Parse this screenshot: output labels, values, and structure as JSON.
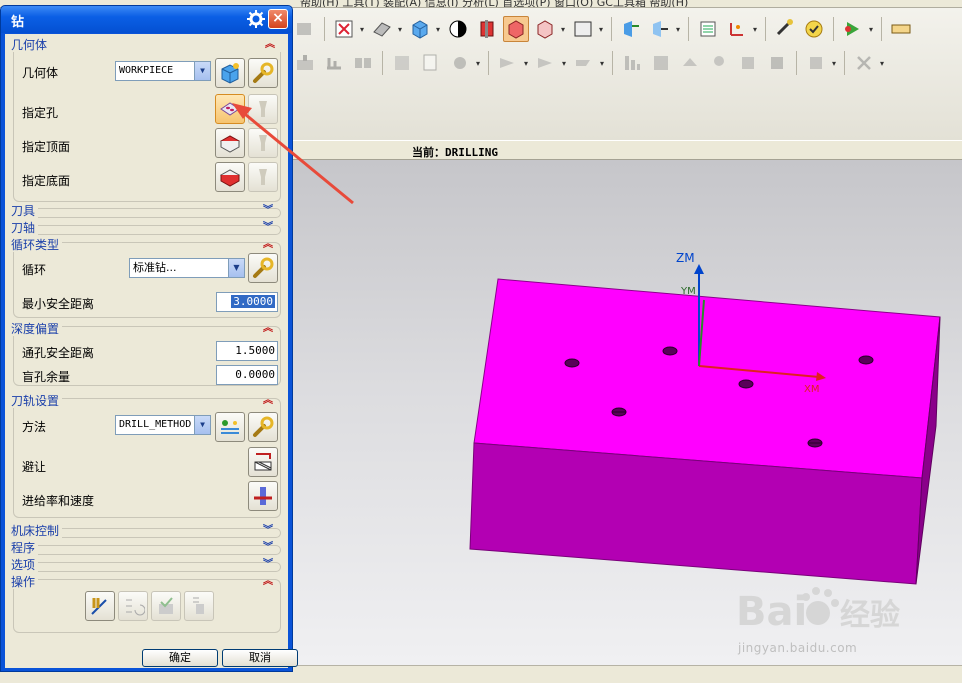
{
  "menubar": {
    "text": "帮助(H)    工具(T)    装配(A)    信息(I)    分析(L)    首选项(P)    窗口(O)    GC工具箱    帮助(H)"
  },
  "statusbar": {
    "current": "当前：DRILLING"
  },
  "viewport": {
    "axis_zm": "ZM",
    "axis_ym": "YM",
    "axis_xm": "XM",
    "part_color": "#ff00ff"
  },
  "dialog": {
    "title": "钻",
    "close": "×",
    "geometry_group": {
      "header": "几何体",
      "geometry_label": "几何体",
      "geometry_value": "WORKPIECE",
      "specify_holes": "指定孔",
      "specify_top": "指定顶面",
      "specify_bottom": "指定底面"
    },
    "tool_header": "刀具",
    "axis_header": "刀轴",
    "cycle_group": {
      "header": "循环类型",
      "cycle_label": "循环",
      "cycle_value": "标准钻...",
      "min_clearance_label": "最小安全距离",
      "min_clearance_value": "3.0000"
    },
    "depth_group": {
      "header": "深度偏置",
      "through_label": "通孔安全距离",
      "through_value": "1.5000",
      "blind_label": "盲孔余量",
      "blind_value": "0.0000"
    },
    "path_group": {
      "header": "刀轨设置",
      "method_label": "方法",
      "method_value": "DRILL_METHOD",
      "avoid_label": "避让",
      "feeds_label": "进给率和速度"
    },
    "machine_header": "机床控制",
    "program_header": "程序",
    "options_header": "选项",
    "actions_header": "操作",
    "ok": "确定",
    "cancel": "取消"
  },
  "colors": {
    "accent_red": "#c01818",
    "header_blue": "#1a3faa",
    "annotation_arrow": "#e84a3a"
  },
  "watermark": {
    "brand": "Bai经验",
    "url": "jingyan.baidu.com"
  }
}
